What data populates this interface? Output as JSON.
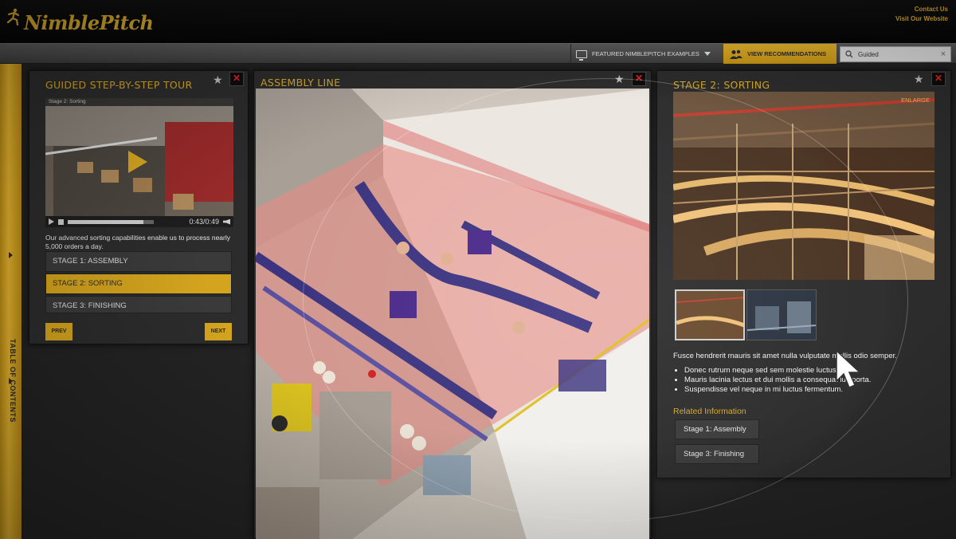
{
  "brand": {
    "name": "NimblePitch",
    "accent": "#d4a82a"
  },
  "header": {
    "links": [
      "Contact Us",
      "Visit Our Website"
    ]
  },
  "toolbar": {
    "featured_label": "FEATURED NIMBLEPITCH EXAMPLES",
    "recommendations_label": "VIEW RECOMMENDATIONS",
    "search_value": "Guided"
  },
  "toc": {
    "label": "TABLE OF CONTENTS"
  },
  "tour": {
    "title": "GUIDED STEP-BY-STEP TOUR",
    "video_caption": "Stage 2: Sorting",
    "video_time": "0:43/0:49",
    "video_progress": 0.88,
    "description": "Our advanced sorting capabilities enable us to process nearly 5,000 orders a day.",
    "stages": [
      {
        "label": "STAGE 1: ASSEMBLY",
        "active": false
      },
      {
        "label": "STAGE 2: SORTING",
        "active": true
      },
      {
        "label": "STAGE 3: FINISHING",
        "active": false
      }
    ],
    "prev_label": "PREV",
    "next_label": "NEXT"
  },
  "assembly": {
    "title": "ASSEMBLY LINE"
  },
  "sorting": {
    "title": "STAGE 2: SORTING",
    "enlarge_label": "ENLARGE",
    "description": "Fusce hendrerit mauris sit amet nulla vulputate mollis odio semper.",
    "bullets": [
      "Donec rutrum neque sed sem molestie luctus.",
      "Mauris lacinia lectus et dui mollis a consequat lus porta.",
      "Suspendisse vel neque in mi luctus fermentum."
    ],
    "related_heading": "Related Information",
    "related_links": [
      "Stage 1: Assembly",
      "Stage 3: Finishing"
    ]
  }
}
